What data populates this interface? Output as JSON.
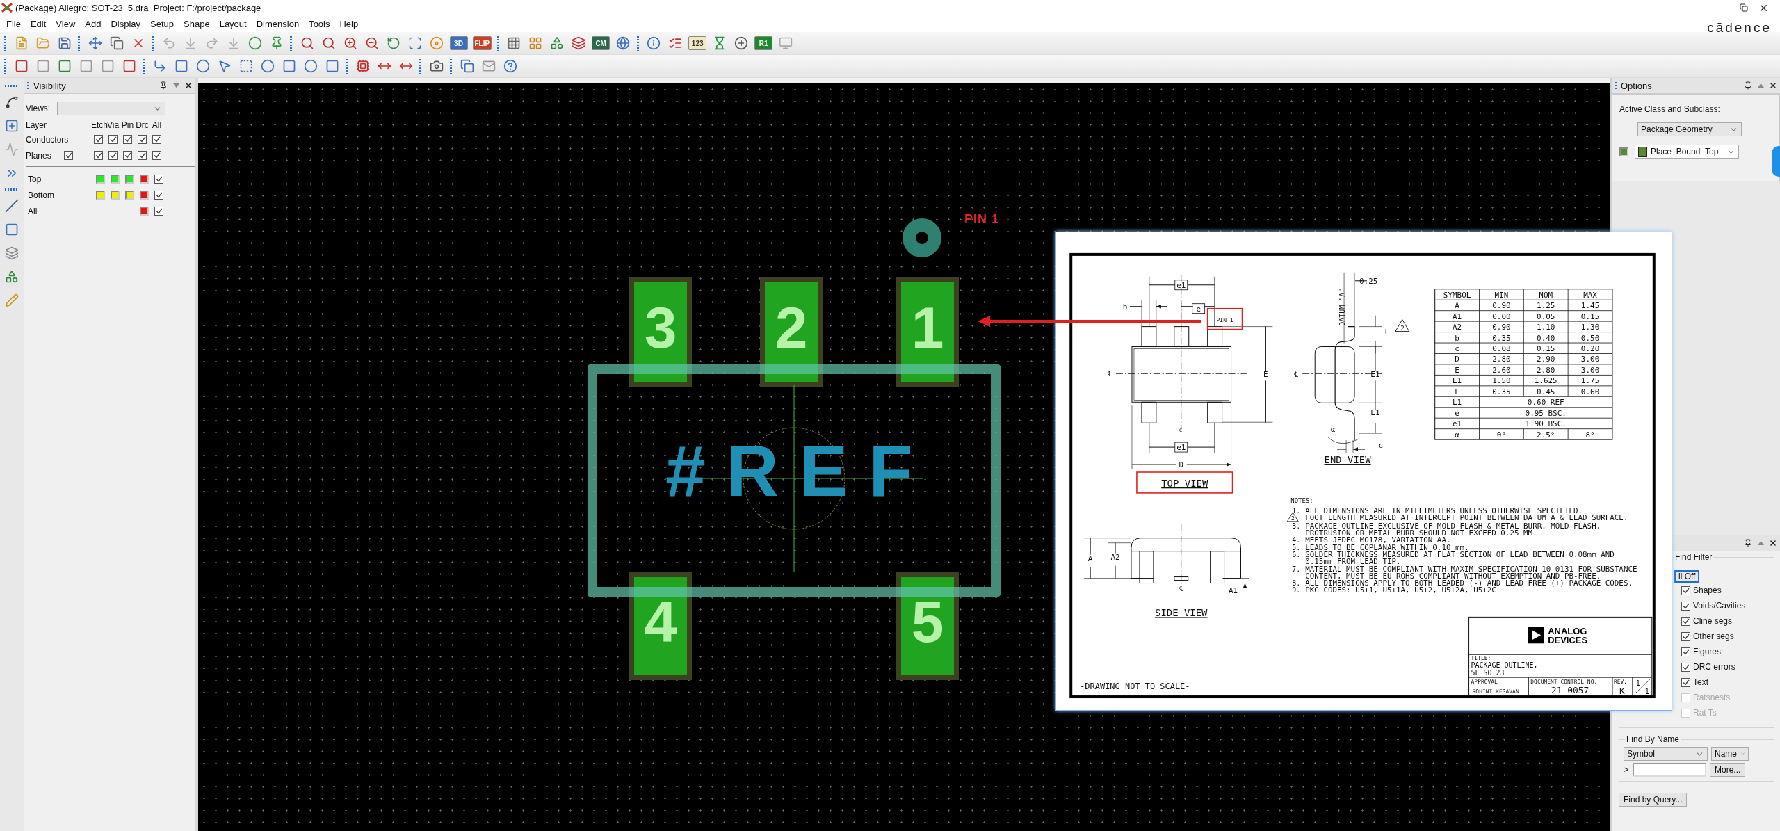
{
  "window": {
    "title": "(Package) Allegro: SOT-23_5.dra  Project: F:/project/package",
    "brand": "cādence"
  },
  "menu": [
    "File",
    "Edit",
    "View",
    "Add",
    "Display",
    "Setup",
    "Shape",
    "Layout",
    "Dimension",
    "Tools",
    "Help"
  ],
  "toolbar_badges": [
    "3D",
    "FLIP",
    "CM",
    "123",
    "R1"
  ],
  "visibility": {
    "title": "Visibility",
    "views_label": "Views:",
    "columns": [
      "Layer",
      "Etch",
      "Via",
      "Pin",
      "Drc",
      "All"
    ],
    "rows": [
      {
        "label": "Conductors",
        "checks": [
          true,
          true,
          true,
          true,
          true
        ]
      },
      {
        "label": "Planes",
        "checked": true,
        "checks": [
          true,
          true,
          true,
          true,
          true
        ]
      }
    ],
    "layers": [
      {
        "label": "Top",
        "swatches": [
          {
            "color": "#22ee22"
          },
          {
            "color": "#22ee22"
          },
          {
            "color": "#22ee22"
          },
          {
            "color": "#ee1111"
          }
        ],
        "checked": true
      },
      {
        "label": "Bottom",
        "swatches": [
          {
            "color": "#eeee00"
          },
          {
            "color": "#eeee00"
          },
          {
            "color": "#eeee00"
          },
          {
            "color": "#ee1111"
          }
        ],
        "checked": true
      },
      {
        "label": "All",
        "swatches": [
          {
            "color": "#ee1111"
          }
        ],
        "checked": true
      }
    ]
  },
  "canvas": {
    "pin_label": "PIN 1",
    "ref_text": "#REF",
    "pads": [
      {
        "label": "3"
      },
      {
        "label": "2"
      },
      {
        "label": "1"
      },
      {
        "label": "4"
      },
      {
        "label": "5"
      }
    ]
  },
  "datasheet": {
    "top_view": {
      "labels": [
        "e1",
        "b",
        "e",
        "℄",
        "E",
        "℄",
        "e1",
        "D"
      ],
      "pin_label": "PIN 1",
      "title": "TOP VIEW"
    },
    "end_view": {
      "labels": [
        "DATUM \"A\"",
        "0.25",
        "L",
        "E1",
        "℄",
        "L1",
        "α",
        "c"
      ],
      "flag": "2",
      "title": "END VIEW"
    },
    "side_view": {
      "labels": [
        "A",
        "A2",
        "℄",
        "A1"
      ],
      "title": "SIDE VIEW"
    },
    "table": {
      "header": [
        "SYMBOL",
        "MIN",
        "NOM",
        "MAX"
      ],
      "rows": [
        [
          "A",
          "0.90",
          "1.25",
          "1.45"
        ],
        [
          "A1",
          "0.00",
          "0.05",
          "0.15"
        ],
        [
          "A2",
          "0.90",
          "1.10",
          "1.30"
        ],
        [
          "b",
          "0.35",
          "0.40",
          "0.50"
        ],
        [
          "c",
          "0.08",
          "0.15",
          "0.20"
        ],
        [
          "D",
          "2.80",
          "2.90",
          "3.00"
        ],
        [
          "E",
          "2.60",
          "2.80",
          "3.00"
        ],
        [
          "E1",
          "1.50",
          "1.625",
          "1.75"
        ],
        [
          "L",
          "0.35",
          "0.45",
          "0.60"
        ],
        [
          "L1",
          "0.60 REF"
        ],
        [
          "e",
          "0.95 BSC."
        ],
        [
          "e1",
          "1.90 BSC."
        ],
        [
          "α",
          "0°",
          "2.5°",
          "8°"
        ]
      ]
    },
    "notes": {
      "title": "NOTES:",
      "items": [
        {
          "number": "1.",
          "kind": "plain",
          "lines": [
            "ALL DIMENSIONS ARE IN MILLIMETERS UNLESS OTHERWISE SPECIFIED."
          ]
        },
        {
          "number": "2",
          "kind": "flag",
          "lines": [
            "FOOT LENGTH MEASURED AT INTERCEPT POINT BETWEEN DATUM A & LEAD SURFACE."
          ]
        },
        {
          "number": "3.",
          "kind": "plain",
          "lines": [
            "PACKAGE OUTLINE EXCLUSIVE OF MOLD FLASH & METAL BURR. MOLD FLASH,",
            "PROTRUSION OR METAL BURR SHOULD NOT EXCEED 0.25 MM."
          ]
        },
        {
          "number": "4.",
          "kind": "plain",
          "lines": [
            "MEETS JEDEC MO178, VARIATION AA."
          ]
        },
        {
          "number": "5.",
          "kind": "plain",
          "lines": [
            "LEADS TO BE COPLANAR WITHIN 0.10 mm."
          ]
        },
        {
          "number": "6.",
          "kind": "plain",
          "lines": [
            "SOLDER THICKNESS MEASURED AT FLAT SECTION OF LEAD BETWEEN 0.08mm AND",
            "0.15mm FROM LEAD TIP."
          ]
        },
        {
          "number": "7.",
          "kind": "plain",
          "lines": [
            "MATERIAL MUST BE COMPLIANT WITH MAXIM SPECIFICATION 10-0131 FOR SUBSTANCE",
            "CONTENT, MUST BE EU ROHS COMPLIANT WITHOUT EXEMPTION AND PB-FREE."
          ]
        },
        {
          "number": "8.",
          "kind": "plain",
          "lines": [
            "ALL DIMENSIONS APPLY TO BOTH LEADED (-) AND LEAD FREE (+) PACKAGE CODES."
          ]
        },
        {
          "number": "9.",
          "kind": "plain",
          "lines": [
            "PKG CODES: U5+1, U5+1A, U5+2, U5+2A, U5+2C"
          ]
        }
      ]
    },
    "scale_note": "-DRAWING NOT TO SCALE-",
    "title_block": {
      "logo": [
        "ANALOG",
        "DEVICES"
      ],
      "title_label": "TITLE:",
      "title_lines": [
        "PACKAGE OUTLINE,",
        "5L SOT23"
      ],
      "approval_label": "APPROVAL",
      "approval": "ROHINI KESAVAN",
      "doc_label": "DOCUMENT CONTROL NO.",
      "doc_no": "21-0057",
      "rev_label": "REV.",
      "rev": "K",
      "sheet": [
        "1",
        "1"
      ]
    }
  },
  "options": {
    "title": "Options",
    "label": "Active Class and Subclass:",
    "class": "Package Geometry",
    "subclass": "Place_Bound_Top",
    "color": "#5a8a30"
  },
  "find": {
    "group": "Find Filter",
    "toggle": "ll Off",
    "filters": [
      {
        "label": "Shapes",
        "checked": true,
        "disabled": false
      },
      {
        "label": "Voids/Cavities",
        "checked": true,
        "disabled": false
      },
      {
        "label": "Cline segs",
        "checked": true,
        "disabled": false
      },
      {
        "label": "Other segs",
        "checked": true,
        "disabled": false
      },
      {
        "label": "Figures",
        "checked": true,
        "disabled": false
      },
      {
        "label": "DRC errors",
        "checked": true,
        "disabled": false
      },
      {
        "label": "Text",
        "checked": true,
        "disabled": false
      },
      {
        "label": "Ratsnests",
        "checked": false,
        "disabled": true
      },
      {
        "label": "Rat Ts",
        "checked": false,
        "disabled": true
      }
    ],
    "by_name": {
      "title": "Find By Name",
      "type": "Symbol",
      "field": "Name",
      "prompt": ">",
      "more": "More..."
    },
    "query": "Find by Query..."
  }
}
